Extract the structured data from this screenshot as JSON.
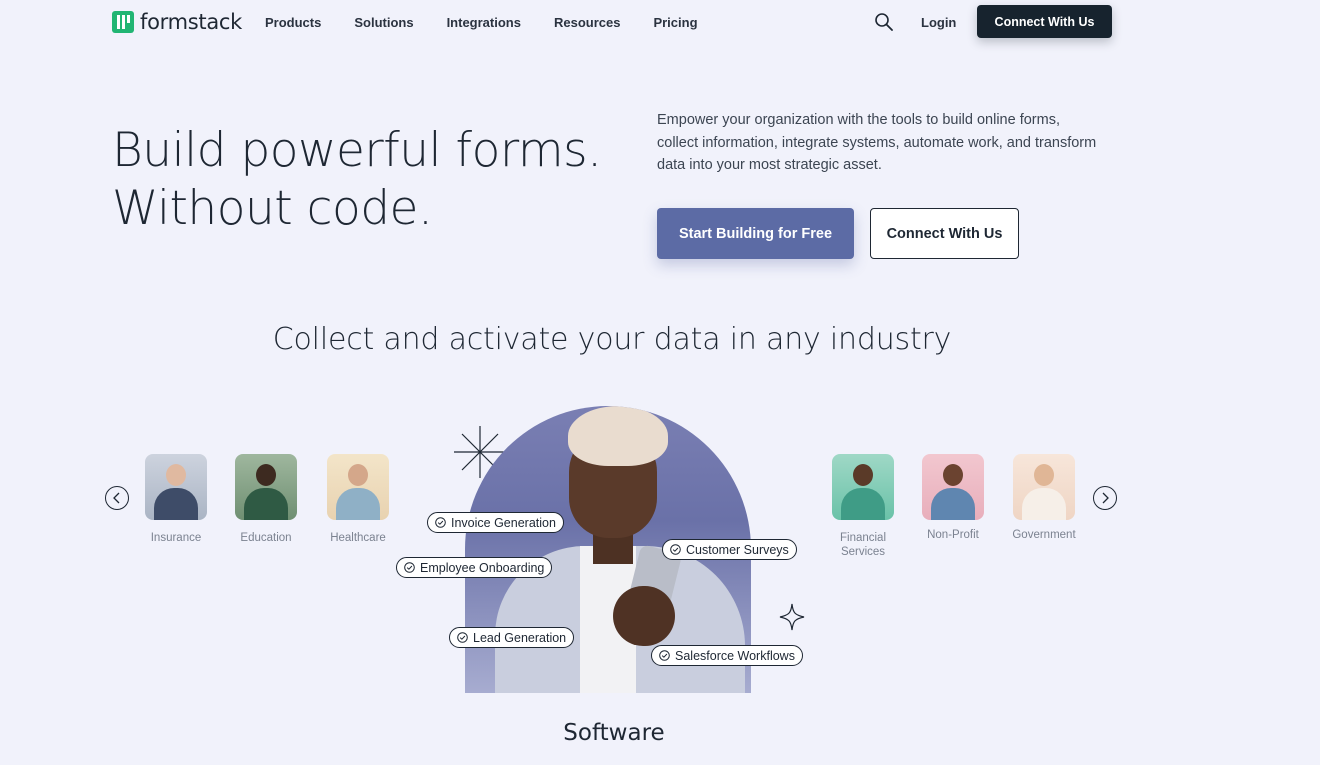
{
  "header": {
    "logo_text": "formstack",
    "nav": [
      "Products",
      "Solutions",
      "Integrations",
      "Resources",
      "Pricing"
    ],
    "login": "Login",
    "cta": "Connect With Us",
    "search_icon": "search-icon"
  },
  "hero": {
    "title_line1": "Build powerful forms.",
    "title_line2": "Without code.",
    "description": "Empower your organization with the tools to build online forms, collect information, integrate systems, automate work, and transform data into your most strategic asset.",
    "primary_button": "Start Building for Free",
    "secondary_button": "Connect With Us"
  },
  "industries": {
    "title": "Collect and activate your data in any industry",
    "left": [
      {
        "label": "Insurance"
      },
      {
        "label": "Education"
      },
      {
        "label": "Healthcare"
      }
    ],
    "right": [
      {
        "label": "Financial Services"
      },
      {
        "label": "Non-Profit"
      },
      {
        "label": "Government"
      }
    ],
    "tags": [
      "Invoice Generation",
      "Employee Onboarding",
      "Customer Surveys",
      "Lead Generation",
      "Salesforce Workflows"
    ],
    "current": "Software",
    "prev_icon": "chevron-left-icon",
    "next_icon": "chevron-right-icon"
  },
  "colors": {
    "background": "#f1f2fb",
    "brand_green": "#21b573",
    "dark": "#17232e",
    "primary": "#5c6ba5"
  }
}
